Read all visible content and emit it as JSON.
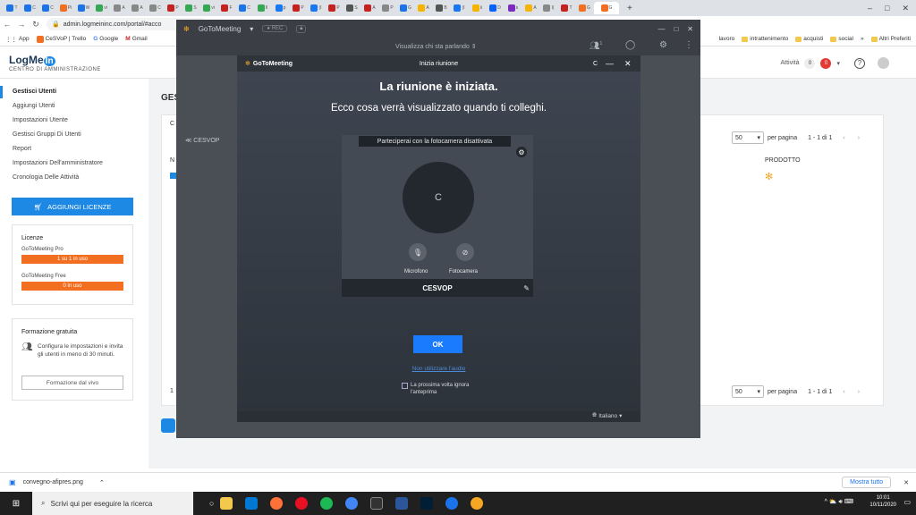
{
  "browser": {
    "tabs": [
      {
        "label": "T",
        "color": "#1a73e8"
      },
      {
        "label": "C",
        "color": "#1a73e8"
      },
      {
        "label": "C",
        "color": "#1a73e8"
      },
      {
        "label": "Pi",
        "color": "#f26f21"
      },
      {
        "label": "W",
        "color": "#1a73e8"
      },
      {
        "label": "vi",
        "color": "#34a853"
      },
      {
        "label": "A",
        "color": "#888"
      },
      {
        "label": "A",
        "color": "#888"
      },
      {
        "label": "C",
        "color": "#888"
      },
      {
        "label": "P",
        "color": "#c5221f"
      },
      {
        "label": "S",
        "color": "#34a853"
      },
      {
        "label": "vi",
        "color": "#34a853"
      },
      {
        "label": "F",
        "color": "#c5221f"
      },
      {
        "label": "C",
        "color": "#1a73e8"
      },
      {
        "label": "II",
        "color": "#34a853"
      },
      {
        "label": "p",
        "color": "#1877f2"
      },
      {
        "label": "P",
        "color": "#c5221f"
      },
      {
        "label": "(I",
        "color": "#1877f2"
      },
      {
        "label": "P",
        "color": "#c5221f"
      },
      {
        "label": "S",
        "color": "#555"
      },
      {
        "label": "A",
        "color": "#c5221f"
      },
      {
        "label": "P",
        "color": "#888"
      },
      {
        "label": "G",
        "color": "#1a73e8"
      },
      {
        "label": "A",
        "color": "#f4b400"
      },
      {
        "label": "B",
        "color": "#555"
      },
      {
        "label": "(I",
        "color": "#1877f2"
      },
      {
        "label": "ii",
        "color": "#f4b400"
      },
      {
        "label": "D",
        "color": "#0061ff"
      },
      {
        "label": "s",
        "color": "#7b2cbf"
      },
      {
        "label": "A",
        "color": "#f4b400"
      },
      {
        "label": "I(",
        "color": "#888"
      },
      {
        "label": "T",
        "color": "#c5221f"
      },
      {
        "label": "G",
        "color": "#f26f21"
      },
      {
        "label": "G",
        "color": "#f26f21"
      }
    ],
    "active_tab_label": "G",
    "new_tab": "+",
    "window_controls": {
      "minimize": "–",
      "maximize": "□",
      "close": "✕"
    },
    "url": "admin.logmeininc.com/portal/#acco",
    "bookmarks": [
      {
        "label": "App"
      },
      {
        "label": "CeSVoP | Trello"
      },
      {
        "label": "Google"
      },
      {
        "label": "Gmail"
      }
    ],
    "bookmarks_right": [
      {
        "label": "lavoro"
      },
      {
        "label": "intrattenimento"
      },
      {
        "label": "acquisti"
      },
      {
        "label": "social"
      },
      {
        "label": "»"
      },
      {
        "label": "Altri Preferiti"
      }
    ]
  },
  "logmein": {
    "logo": "LogMe",
    "logo_in": "In",
    "subtitle": "CENTRO DI AMMINISTRAZIONE",
    "activity_label": "Attività",
    "activity_count_1": "0",
    "activity_count_2": "0",
    "help": "?",
    "heading_partial": "GES",
    "nav": [
      {
        "label": "Gestisci Utenti",
        "active": true
      },
      {
        "label": "Aggiungi Utenti"
      },
      {
        "label": "Impostazioni Utente"
      },
      {
        "label": "Gestisci Gruppi Di Utenti"
      },
      {
        "label": "Report"
      },
      {
        "label": "Impostazioni Dell'amministratore"
      },
      {
        "label": "Cronologia Delle Attività"
      }
    ],
    "add_licenses": "AGGIUNGI LICENZE",
    "licenses": {
      "title": "Licenze",
      "items": [
        {
          "name": "GoToMeeting Pro",
          "usage": "1 su 1 in uso"
        },
        {
          "name": "GoToMeeting Free",
          "usage": "0 in uso"
        }
      ]
    },
    "training": {
      "title": "Formazione gratuita",
      "text": "Configura le impostazioni e invita gli utenti in meno di 30 minuti.",
      "button": "Formazione dal vivo"
    },
    "table": {
      "per_page_value": "50",
      "per_page_label": "per pagina",
      "range": "1 - 1 di 1",
      "prev": "‹",
      "next": "›",
      "column_product": "PRODOTTO",
      "partial_c": "C",
      "partial_n": "N",
      "partial_1": "1"
    }
  },
  "gotomeeting": {
    "app_name": "GoToMeeting",
    "rec": "REC",
    "view_label": "Visualizza chi sta parlando",
    "participant_count": "1",
    "side_label": "CESVOP",
    "dialog": {
      "brand": "GoToMeeting",
      "title": "Inizia riunione",
      "letter": "C",
      "heading": "La riunione è iniziata.",
      "subheading": "Ecco cosa verrà visualizzato quando ti colleghi.",
      "camera_notice": "Parteciperai con la fotocamera disattivata",
      "avatar_initial": "C",
      "mic_label": "Microfono",
      "camera_label": "Fotocamera",
      "display_name": "CESVOP",
      "ok": "OK",
      "no_audio": "Non utilizzare l'audio",
      "checkbox_label": "La prossima volta ignora l'anteprima",
      "language": "Italiano"
    }
  },
  "downloads": {
    "file": "convegno-afipres.png",
    "show_all": "Mostra tutto",
    "close": "✕"
  },
  "taskbar": {
    "search_placeholder": "Scrivi qui per eseguire la ricerca",
    "time": "10:01",
    "date": "10/11/2020"
  }
}
